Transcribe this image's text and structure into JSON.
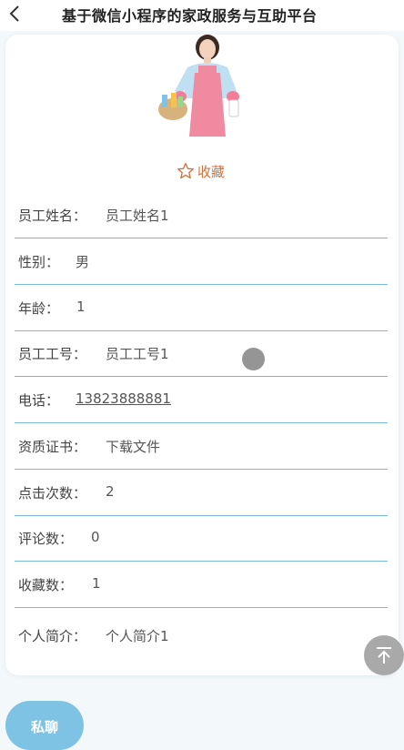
{
  "header": {
    "title": "基于微信小程序的家政服务与互助平台",
    "back_icon": "chevron-left-icon"
  },
  "profile": {
    "photo_alt": "staff photo",
    "favorite_label": "收藏",
    "favorite_icon": "star-outline-icon",
    "favorite_color": "#d1733b"
  },
  "fields": [
    {
      "label": "员工姓名：",
      "value": "员工姓名1"
    },
    {
      "label": "性别：",
      "value": "男"
    },
    {
      "label": "年龄：",
      "value": "1"
    },
    {
      "label": "员工工号：",
      "value": "员工工号1"
    },
    {
      "label": "电话：",
      "value": "13823888881"
    },
    {
      "label": "资质证书：",
      "value": "下载文件"
    },
    {
      "label": "点击次数：",
      "value": "2"
    },
    {
      "label": "评论数：",
      "value": "0"
    },
    {
      "label": "收藏数：",
      "value": "1"
    },
    {
      "label": "个人简介：",
      "value": "个人简介1"
    }
  ],
  "actions": {
    "chat_label": "私聊",
    "chat_color": "#7ec3e4",
    "to_top_icon": "arrow-up-to-top-icon",
    "divider_color": "#7ab8d8"
  }
}
